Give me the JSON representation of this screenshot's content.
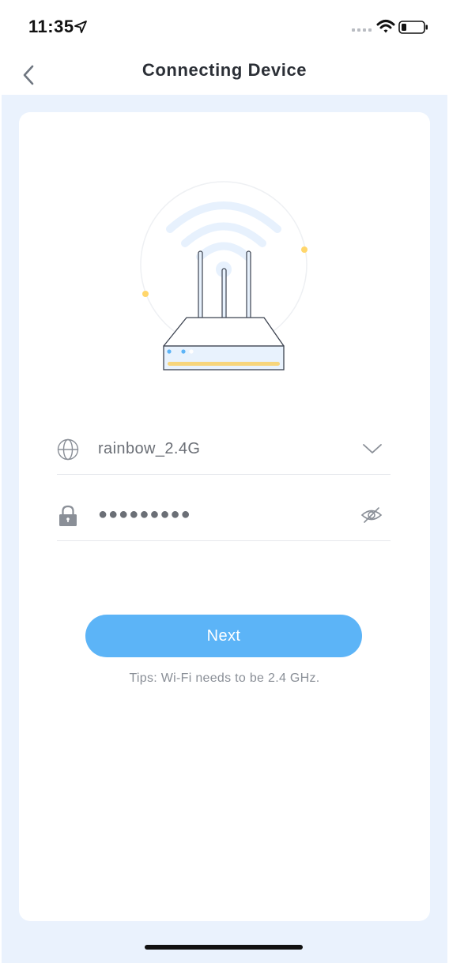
{
  "status_bar": {
    "time": "11:35",
    "icons": [
      "location-arrow-icon",
      "cell-signal-icon",
      "wifi-icon",
      "battery-icon"
    ]
  },
  "nav": {
    "title": "Connecting Device",
    "back_icon": "chevron-left-icon"
  },
  "form": {
    "ssid": {
      "icon": "globe-icon",
      "value": "rainbow_2.4G",
      "action_icon": "chevron-down-icon"
    },
    "password": {
      "icon": "lock-icon",
      "value": "●●●●●●●●●",
      "action_icon": "eye-hidden-icon"
    }
  },
  "next_label": "Next",
  "tips": "Tips: Wi-Fi needs to be 2.4 GHz.",
  "colors": {
    "accent": "#5cb4f7",
    "page_bg": "#eaf2fd",
    "card_bg": "#ffffff",
    "title": "#2b2f36",
    "router_stripe": "#f7d57b",
    "router_dots": "#ffd66b"
  }
}
